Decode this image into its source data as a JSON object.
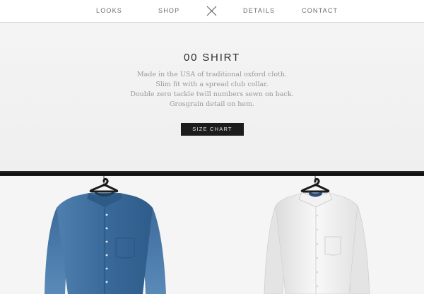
{
  "nav": {
    "items": [
      {
        "label": "LOOKS"
      },
      {
        "label": "SHOP"
      },
      {
        "label": "DETAILS"
      },
      {
        "label": "CONTACT"
      }
    ],
    "logo_icon": "cross-logo-icon"
  },
  "product": {
    "title": "00 SHIRT",
    "description": [
      "Made in the USA of traditional oxford cloth.",
      "Slim fit with a spread club collar.",
      "Double zero tackle twill numbers sewn on back.",
      "Grosgrain detail on hem."
    ],
    "size_chart_label": "SIZE CHART"
  },
  "variants": [
    {
      "color_name": "blue",
      "color": "#3a6a9a"
    },
    {
      "color_name": "white",
      "color": "#f4f4f4"
    }
  ],
  "colors": {
    "nav_bg": "#ffffff",
    "page_bg": "#f2f2f2",
    "button_bg": "#1c1c1c",
    "rack": "#111111"
  }
}
